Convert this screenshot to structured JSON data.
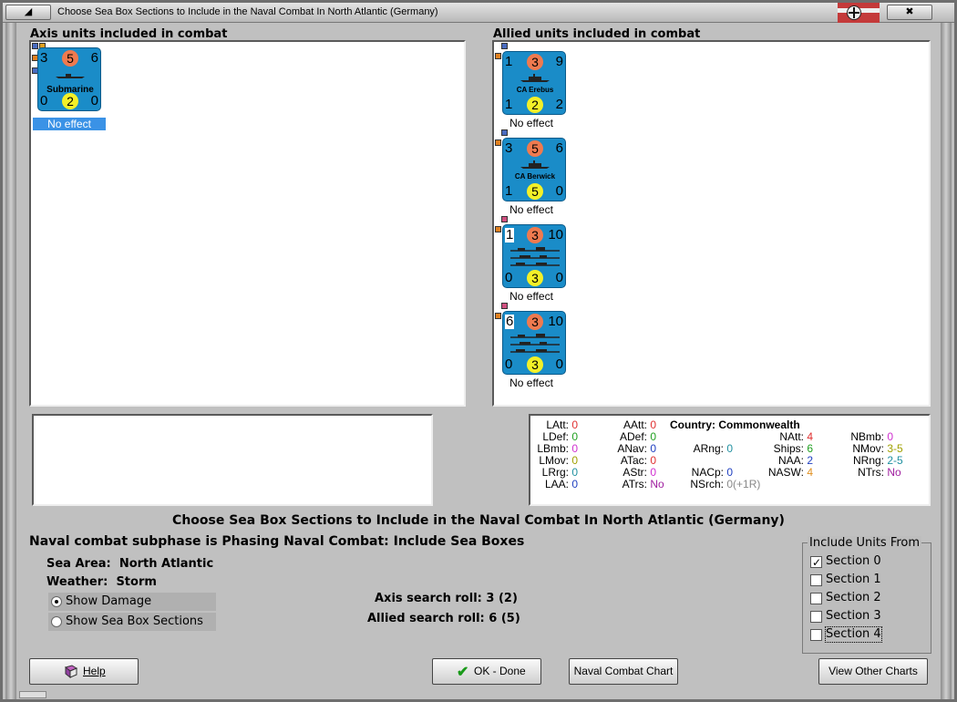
{
  "window": {
    "title": "Choose Sea Box Sections to Include in the Naval Combat In North Atlantic (Germany)",
    "minimize_glyph": "◢",
    "close_glyph": "✖",
    "flag_icon": "kriegsmarine-flag"
  },
  "axis_panel": {
    "title": "Axis units included in combat",
    "units": [
      {
        "name": "Submarine",
        "tl": "3",
        "tc": "5",
        "tr": "6",
        "bl": "0",
        "bc": "2",
        "br": "0",
        "effect": "No effect",
        "selected": true
      }
    ]
  },
  "allied_panel": {
    "title": "Allied units included in combat",
    "units": [
      {
        "name": "CA Erebus",
        "tl": "1",
        "tc": "3",
        "tr": "9",
        "bl": "1",
        "bc": "2",
        "br": "2",
        "effect": "No effect"
      },
      {
        "name": "CA Berwick",
        "tl": "3",
        "tc": "5",
        "tr": "6",
        "bl": "1",
        "bc": "5",
        "br": "0",
        "effect": "No effect"
      },
      {
        "name": "",
        "tl": "1",
        "tc": "3",
        "tr": "10",
        "bl": "0",
        "bc": "3",
        "br": "0",
        "effect": "No effect"
      },
      {
        "name": "",
        "tl": "6",
        "tc": "3",
        "tr": "10",
        "bl": "0",
        "bc": "3",
        "br": "0",
        "effect": "No effect"
      }
    ]
  },
  "stats": {
    "LAtt": "0",
    "LDef": "0",
    "LBmb": "0",
    "LMov": "0",
    "LRrg": "0",
    "LAA": "0",
    "AAtt": "0",
    "ADef": "0",
    "ANav": "0",
    "ATac": "0",
    "AStr": "0",
    "ATrs": "No",
    "country_label": "Country:",
    "country": "Commonwealth",
    "ARng": "0",
    "NACp": "0",
    "NSrch": "0(+1R)",
    "NAtt": "4",
    "Ships": "6",
    "NAA": "2",
    "NASW": "4",
    "NBmb": "0",
    "NMov": "3-5",
    "NRng": "2-5",
    "NTrs": "No"
  },
  "main": {
    "heading": "Choose Sea Box Sections to Include in the Naval Combat In North Atlantic (Germany)",
    "subphase": "Naval combat subphase is Phasing Naval Combat: Include Sea Boxes",
    "sea_area_label": "Sea Area:",
    "sea_area": "North Atlantic",
    "weather_label": "Weather:",
    "weather": "Storm",
    "show_damage": "Show Damage",
    "show_sections": "Show Sea Box Sections",
    "axis_roll_label": "Axis search roll:",
    "axis_roll": "3 (2)",
    "allied_roll_label": "Allied search roll:",
    "allied_roll": "6 (5)"
  },
  "include": {
    "legend": "Include Units From",
    "sections": [
      {
        "label": "Section 0",
        "checked": true
      },
      {
        "label": "Section 1",
        "checked": false
      },
      {
        "label": "Section 2",
        "checked": false
      },
      {
        "label": "Section 3",
        "checked": false
      },
      {
        "label": "Section 4",
        "checked": false
      }
    ]
  },
  "buttons": {
    "help": "Help",
    "ok": "OK - Done",
    "naval_chart": "Naval Combat Chart",
    "other_charts": "View Other Charts"
  },
  "colors": {
    "counter_blue": "#1a8cc8",
    "attack_circle": "#ef7a4f",
    "defense_circle": "#f3f028",
    "selection": "#3a92e6"
  }
}
